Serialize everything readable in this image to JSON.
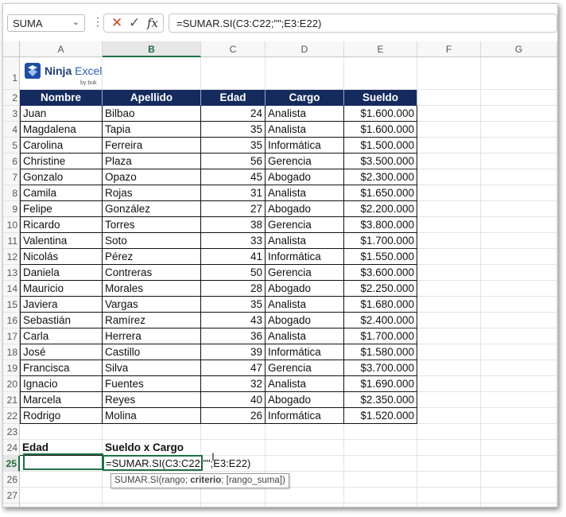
{
  "formula_bar": {
    "name_box": "SUMA",
    "formula": "=SUMAR.SI(C3:C22;\"\";E3:E22)"
  },
  "columns": [
    "A",
    "B",
    "C",
    "D",
    "E",
    "F",
    "G"
  ],
  "logo": {
    "brand": "Ninja",
    "brand2": "Excel",
    "sub": "by buk"
  },
  "table_headers": [
    "Nombre",
    "Apellido",
    "Edad",
    "Cargo",
    "Sueldo"
  ],
  "rows": [
    [
      "Juan",
      "Bilbao",
      "24",
      "Analista",
      "$1.600.000"
    ],
    [
      "Magdalena",
      "Tapia",
      "35",
      "Analista",
      "$1.600.000"
    ],
    [
      "Carolina",
      "Ferreira",
      "35",
      "Informática",
      "$1.500.000"
    ],
    [
      "Christine",
      "Plaza",
      "56",
      "Gerencia",
      "$3.500.000"
    ],
    [
      "Gonzalo",
      "Opazo",
      "45",
      "Abogado",
      "$2.300.000"
    ],
    [
      "Camila",
      "Rojas",
      "31",
      "Analista",
      "$1.650.000"
    ],
    [
      "Felipe",
      "González",
      "27",
      "Abogado",
      "$2.200.000"
    ],
    [
      "Ricardo",
      "Torres",
      "38",
      "Gerencia",
      "$3.800.000"
    ],
    [
      "Valentina",
      "Soto",
      "33",
      "Analista",
      "$1.700.000"
    ],
    [
      "Nicolás",
      "Pérez",
      "41",
      "Informática",
      "$1.550.000"
    ],
    [
      "Daniela",
      "Contreras",
      "50",
      "Gerencia",
      "$3.600.000"
    ],
    [
      "Mauricio",
      "Morales",
      "28",
      "Abogado",
      "$2.250.000"
    ],
    [
      "Javiera",
      "Vargas",
      "35",
      "Analista",
      "$1.680.000"
    ],
    [
      "Sebastián",
      "Ramírez",
      "43",
      "Abogado",
      "$2.400.000"
    ],
    [
      "Carla",
      "Herrera",
      "36",
      "Analista",
      "$1.700.000"
    ],
    [
      "José",
      "Castillo",
      "39",
      "Informática",
      "$1.580.000"
    ],
    [
      "Francisca",
      "Silva",
      "47",
      "Gerencia",
      "$3.700.000"
    ],
    [
      "Ignacio",
      "Fuentes",
      "32",
      "Analista",
      "$1.690.000"
    ],
    [
      "Marcela",
      "Reyes",
      "40",
      "Abogado",
      "$2.350.000"
    ],
    [
      "Rodrigo",
      "Molina",
      "26",
      "Informática",
      "$1.520.000"
    ]
  ],
  "summary": {
    "label_a": "Edad",
    "label_b": "Sueldo x Cargo"
  },
  "edit_text": "=SUMAR.SI(C3:C22;\"\";E3:E22)",
  "tooltip": {
    "fn": "SUMAR.SI(rango; ",
    "bold": "criterio",
    "rest": "; [rango_suma])"
  },
  "colors": {
    "header_bg": "#152b5e",
    "accent": "#1e7145",
    "cancel": "#d24726"
  }
}
